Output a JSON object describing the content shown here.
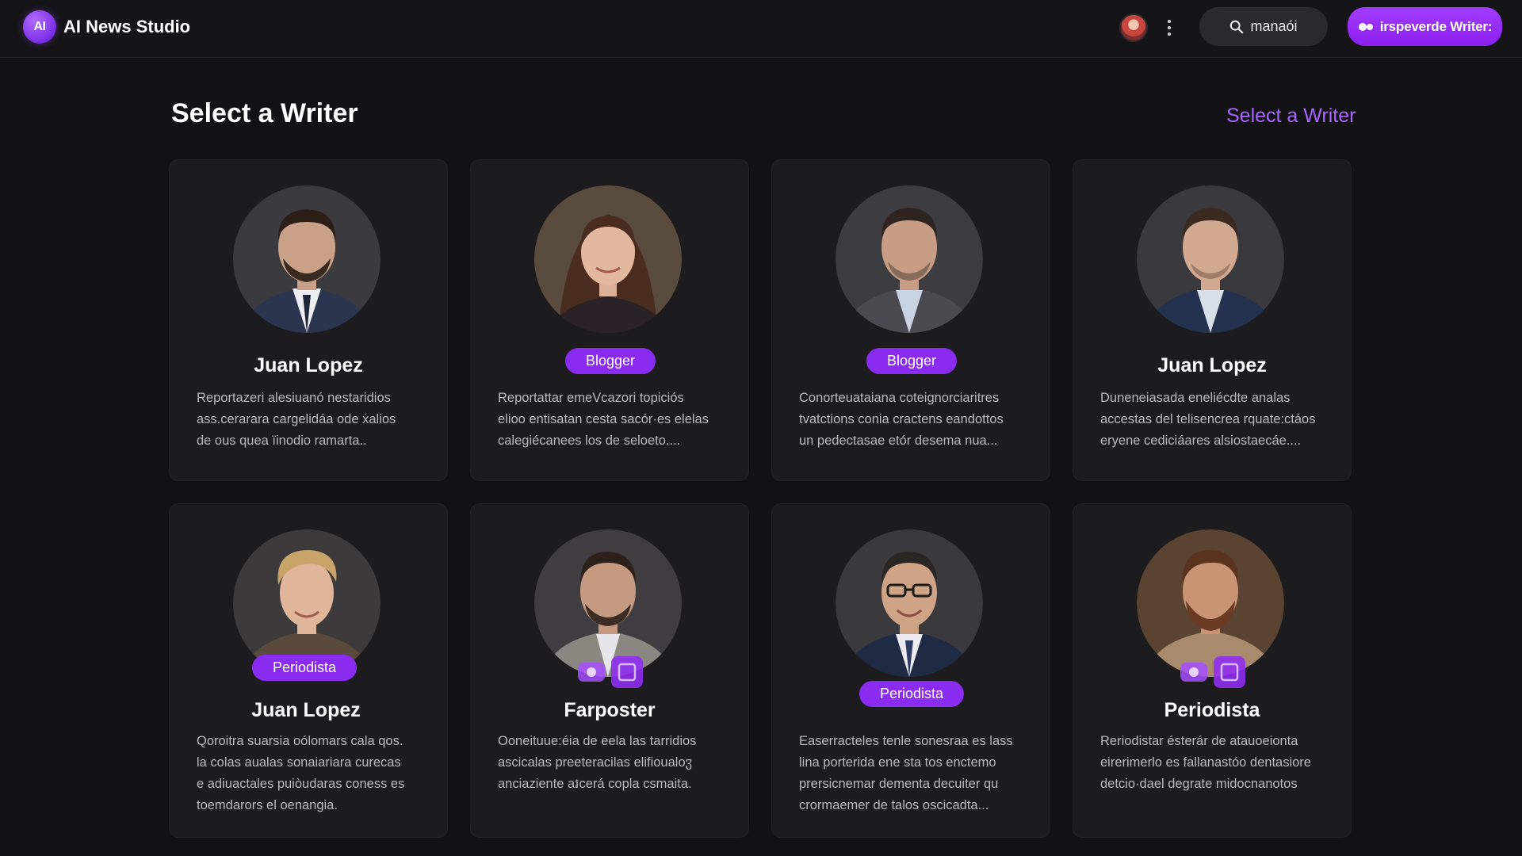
{
  "app": {
    "title": "AI News Studio",
    "logo_text": "AI"
  },
  "header": {
    "search_label": "manaói",
    "cta_label": "irspeverde Writer:"
  },
  "page": {
    "title": "Select a Writer",
    "link_label": "Select a Writer"
  },
  "colors": {
    "accent": "#8a2cf0",
    "link": "#a864ff",
    "background": "#121113",
    "card": "#1c1b1e"
  },
  "writers": [
    {
      "name": "Juan Lopez",
      "badge": "",
      "desc": [
        "Reportazeri alesiuanó nestaridios",
        "ass.cerarara cargelidáa ode ẋalios",
        "de ous quea ïinodio ramarta.."
      ]
    },
    {
      "name": "",
      "badge": "Blogger",
      "desc": [
        "Reportattar emeVcazori topiciós",
        "elioo entisatan cesta sacór·es elelas",
        "calegiécanees los de seloeto...."
      ]
    },
    {
      "name": "",
      "badge": "Blogger",
      "desc": [
        "Conorteuataiana coteignorciaritres",
        "tvatctions conia cractens eandottos",
        "un pedectasae etór desema nua..."
      ]
    },
    {
      "name": "Juan Lopez",
      "badge": "",
      "desc": [
        "Duneneiasada eneliécdte analas",
        "accestas del telisencrea rquate:ctáos",
        "eryene cediciáares alsiostaecáe...."
      ]
    },
    {
      "name": "Juan Lopez",
      "badge": "Periodista",
      "desc": [
        "Qoroitra suarsia oólomars cala qos.",
        "la colas aualas sonaiariara curecas",
        "e adiuactales puiòudaras coness es",
        "toemdarors el oenangia."
      ]
    },
    {
      "name": "Farposter",
      "badge": "",
      "desc": [
        "Ooneituue:éia de eela las tarridios",
        "ascicalas preeteracilas elifioualoჳ",
        "anciaziente aរcerá copla csmaita."
      ]
    },
    {
      "name": "",
      "badge": "Periodista",
      "desc": [
        "Easerracteles tenle sonesraa es lass",
        "lina porterida ene sta tos enctemo",
        "prersicnemar dementa decuiter qu",
        "crormaemer de talos oscicadta..."
      ]
    },
    {
      "name": "Periodista",
      "badge": "",
      "desc": [
        "Reriodistar ésterár de atauoeionta",
        "eirerimerlo es fallanastóo dentasiore",
        "detcio·dael degrate midocnanotos"
      ]
    }
  ]
}
